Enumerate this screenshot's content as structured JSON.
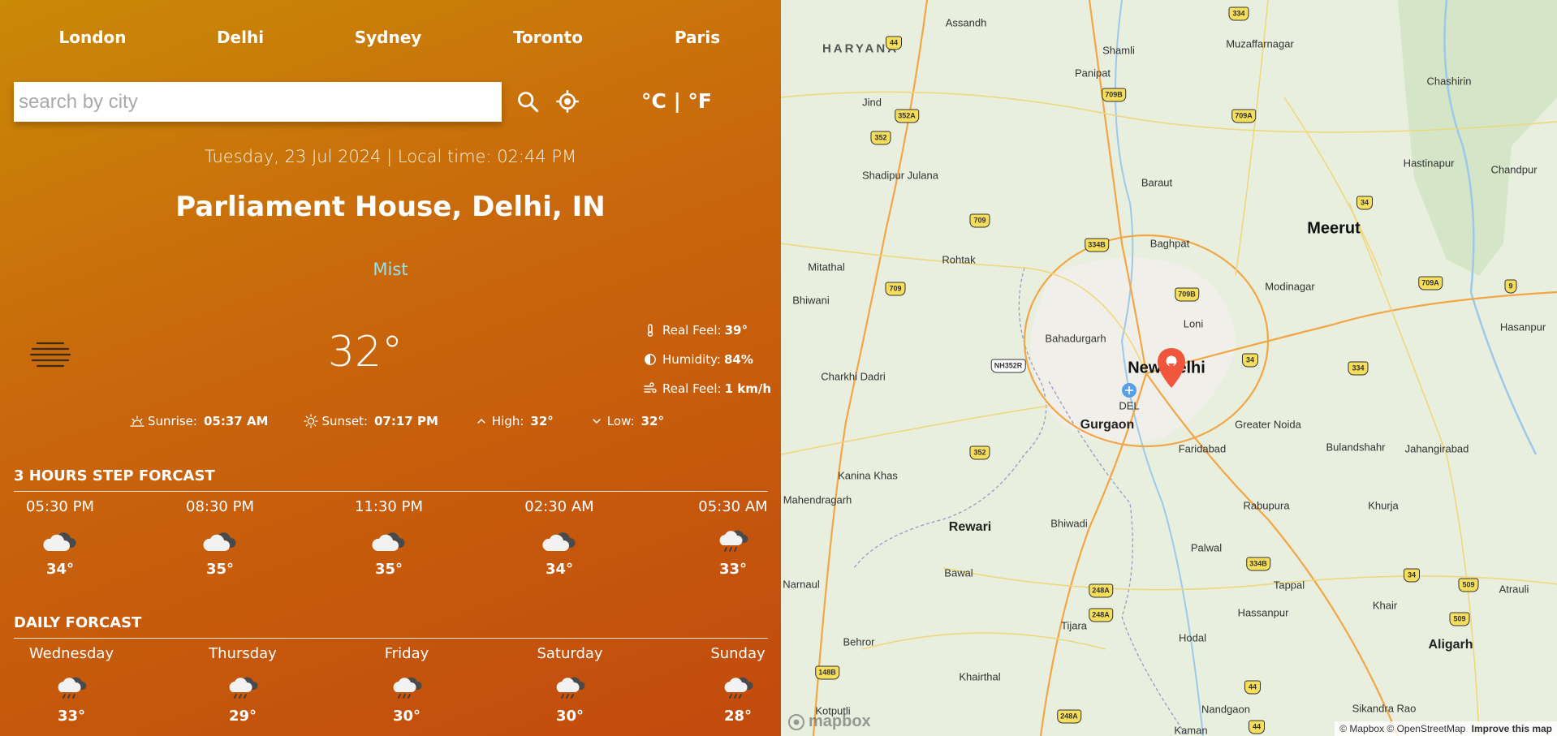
{
  "top_cities": [
    "London",
    "Delhi",
    "Sydney",
    "Toronto",
    "Paris"
  ],
  "search": {
    "placeholder": "search by city"
  },
  "units": {
    "celsius": "°C",
    "separator": " | ",
    "fahrenheit": "°F"
  },
  "datetime": "Tuesday, 23 Jul 2024 | Local time: 02:44 PM",
  "location": "Parliament House, Delhi, IN",
  "condition": "Mist",
  "temperature": "32°",
  "details": [
    {
      "icon": "thermometer-icon",
      "label": "Real Feel:",
      "value": "39°"
    },
    {
      "icon": "humidity-drop-icon",
      "label": "Humidity:",
      "value": "84%"
    },
    {
      "icon": "wind-icon",
      "label": "Real Feel:",
      "value": "1 km/h"
    }
  ],
  "sun": [
    {
      "icon": "sunrise-icon",
      "label": "Sunrise:",
      "value": "05:37 AM"
    },
    {
      "icon": "sunset-icon",
      "label": "Sunset:",
      "value": "07:17 PM"
    },
    {
      "icon": "chevron-up-icon",
      "label": "High:",
      "value": "32°"
    },
    {
      "icon": "chevron-down-icon",
      "label": "Low:",
      "value": "32°"
    }
  ],
  "hourly": {
    "title": "3 HOURS STEP FORCAST",
    "items": [
      {
        "label": "05:30 PM",
        "temp": "34°",
        "icon": "cloudy-icon"
      },
      {
        "label": "08:30 PM",
        "temp": "35°",
        "icon": "cloudy-icon"
      },
      {
        "label": "11:30 PM",
        "temp": "35°",
        "icon": "cloudy-icon"
      },
      {
        "label": "02:30 AM",
        "temp": "34°",
        "icon": "cloudy-icon"
      },
      {
        "label": "05:30 AM",
        "temp": "33°",
        "icon": "rain-cloud-icon"
      }
    ]
  },
  "daily": {
    "title": "DAILY FORCAST",
    "items": [
      {
        "label": "Wednesday",
        "temp": "33°",
        "icon": "rain-cloud-icon"
      },
      {
        "label": "Thursday",
        "temp": "29°",
        "icon": "rain-cloud-icon"
      },
      {
        "label": "Friday",
        "temp": "30°",
        "icon": "rain-cloud-icon"
      },
      {
        "label": "Saturday",
        "temp": "30°",
        "icon": "rain-cloud-icon"
      },
      {
        "label": "Sunday",
        "temp": "28°",
        "icon": "rain-cloud-icon"
      }
    ]
  },
  "map": {
    "labels": [
      {
        "text": "Assandh",
        "size": "small"
      },
      {
        "text": "HARYANA",
        "size": "region"
      },
      {
        "text": "Shamli",
        "size": "small"
      },
      {
        "text": "Muzaffarnagar",
        "size": "small"
      },
      {
        "text": "Chashirin",
        "size": "small"
      },
      {
        "text": "Panipat",
        "size": "small"
      },
      {
        "text": "Jind",
        "size": "small"
      },
      {
        "text": "Hastinapur",
        "size": "small"
      },
      {
        "text": "Chandpur",
        "size": "small"
      },
      {
        "text": "Shadipur Julana",
        "size": "small"
      },
      {
        "text": "Baraut",
        "size": "small"
      },
      {
        "text": "Meerut",
        "size": "large"
      },
      {
        "text": "Baghpat",
        "size": "small"
      },
      {
        "text": "Rohtak",
        "size": "small"
      },
      {
        "text": "Mitathal",
        "size": "small"
      },
      {
        "text": "Modinagar",
        "size": "small"
      },
      {
        "text": "Bhiwani",
        "size": "small"
      },
      {
        "text": "Loni",
        "size": "small"
      },
      {
        "text": "Hasanpur",
        "size": "small"
      },
      {
        "text": "Bahadurgarh",
        "size": "small"
      },
      {
        "text": "New Delhi",
        "size": "large"
      },
      {
        "text": "Charkhi Dadri",
        "size": "small"
      },
      {
        "text": "DEL",
        "size": "small"
      },
      {
        "text": "Gurgaon",
        "size": "medium"
      },
      {
        "text": "Greater Noida",
        "size": "small"
      },
      {
        "text": "Faridabad",
        "size": "small"
      },
      {
        "text": "Bulandshahr",
        "size": "small"
      },
      {
        "text": "Jahangirabad",
        "size": "small"
      },
      {
        "text": "Kanina Khas",
        "size": "small"
      },
      {
        "text": "Mahendragarh",
        "size": "small"
      },
      {
        "text": "Rabupura",
        "size": "small"
      },
      {
        "text": "Khurja",
        "size": "small"
      },
      {
        "text": "Rewari",
        "size": "medium"
      },
      {
        "text": "Bhiwadi",
        "size": "small"
      },
      {
        "text": "Palwal",
        "size": "small"
      },
      {
        "text": "Narnaul",
        "size": "small"
      },
      {
        "text": "Bawal",
        "size": "small"
      },
      {
        "text": "Tappal",
        "size": "small"
      },
      {
        "text": "Atrauli",
        "size": "small"
      },
      {
        "text": "Khair",
        "size": "small"
      },
      {
        "text": "Tijara",
        "size": "small"
      },
      {
        "text": "Hassanpur",
        "size": "small"
      },
      {
        "text": "Behror",
        "size": "small"
      },
      {
        "text": "Hodal",
        "size": "small"
      },
      {
        "text": "Aligarh",
        "size": "medium"
      },
      {
        "text": "Khairthal",
        "size": "small"
      },
      {
        "text": "Kotputli",
        "size": "small"
      },
      {
        "text": "Nandgaon",
        "size": "small"
      },
      {
        "text": "Sikandra Rao",
        "size": "small"
      },
      {
        "text": "Kaman",
        "size": "small"
      }
    ],
    "shields": [
      "334",
      "44",
      "709B",
      "709A",
      "352A",
      "352",
      "709",
      "334B",
      "709B",
      "709",
      "34",
      "709A",
      "9",
      "NH352R",
      "34",
      "334",
      "352",
      "334B",
      "248A",
      "248A",
      "148B",
      "34",
      "509",
      "509",
      "44",
      "248A",
      "44"
    ],
    "attribution": "© Mapbox © OpenStreetMap",
    "improve_link": "Improve this map",
    "logo_text": "mapbox"
  }
}
